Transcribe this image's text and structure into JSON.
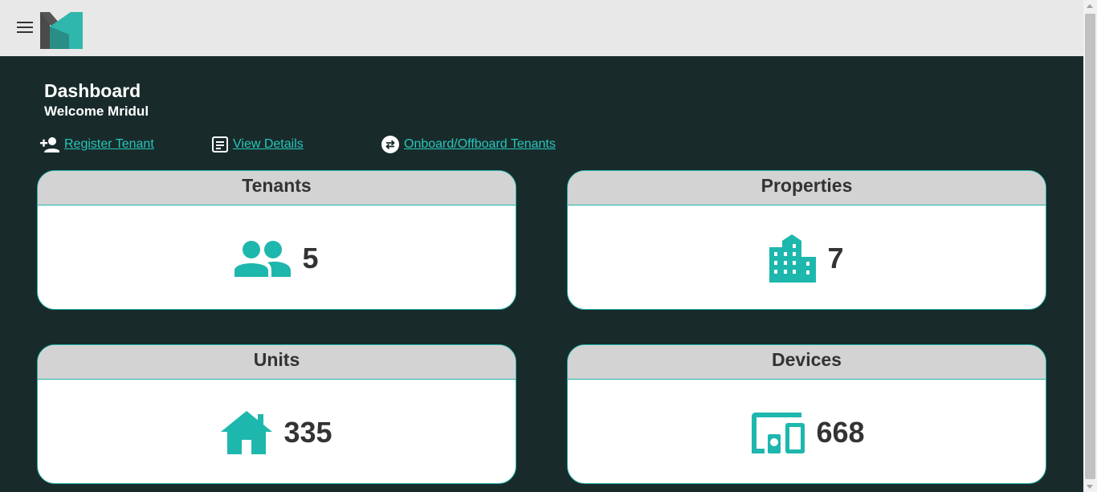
{
  "header": {
    "menu_icon": "hamburger-menu-icon",
    "logo_icon": "m-logo"
  },
  "dashboard": {
    "title": "Dashboard",
    "welcome": "Welcome Mridul"
  },
  "actions": [
    {
      "label": "Register Tenant",
      "icon": "person-add-icon"
    },
    {
      "label": "View Details",
      "icon": "article-icon"
    },
    {
      "label": "Onboard/Offboard Tenants",
      "icon": "swap-circle-icon"
    }
  ],
  "cards": [
    {
      "title": "Tenants",
      "value": "5",
      "icon": "people-icon"
    },
    {
      "title": "Properties",
      "value": "7",
      "icon": "building-icon"
    },
    {
      "title": "Units",
      "value": "335",
      "icon": "house-icon"
    },
    {
      "title": "Devices",
      "value": "668",
      "icon": "devices-icon"
    }
  ],
  "colors": {
    "background": "#182b2a",
    "accent": "#1eb7ad",
    "link": "#27c6bd",
    "card_header": "#d3d3d3",
    "topbar": "#e8e8e8"
  }
}
